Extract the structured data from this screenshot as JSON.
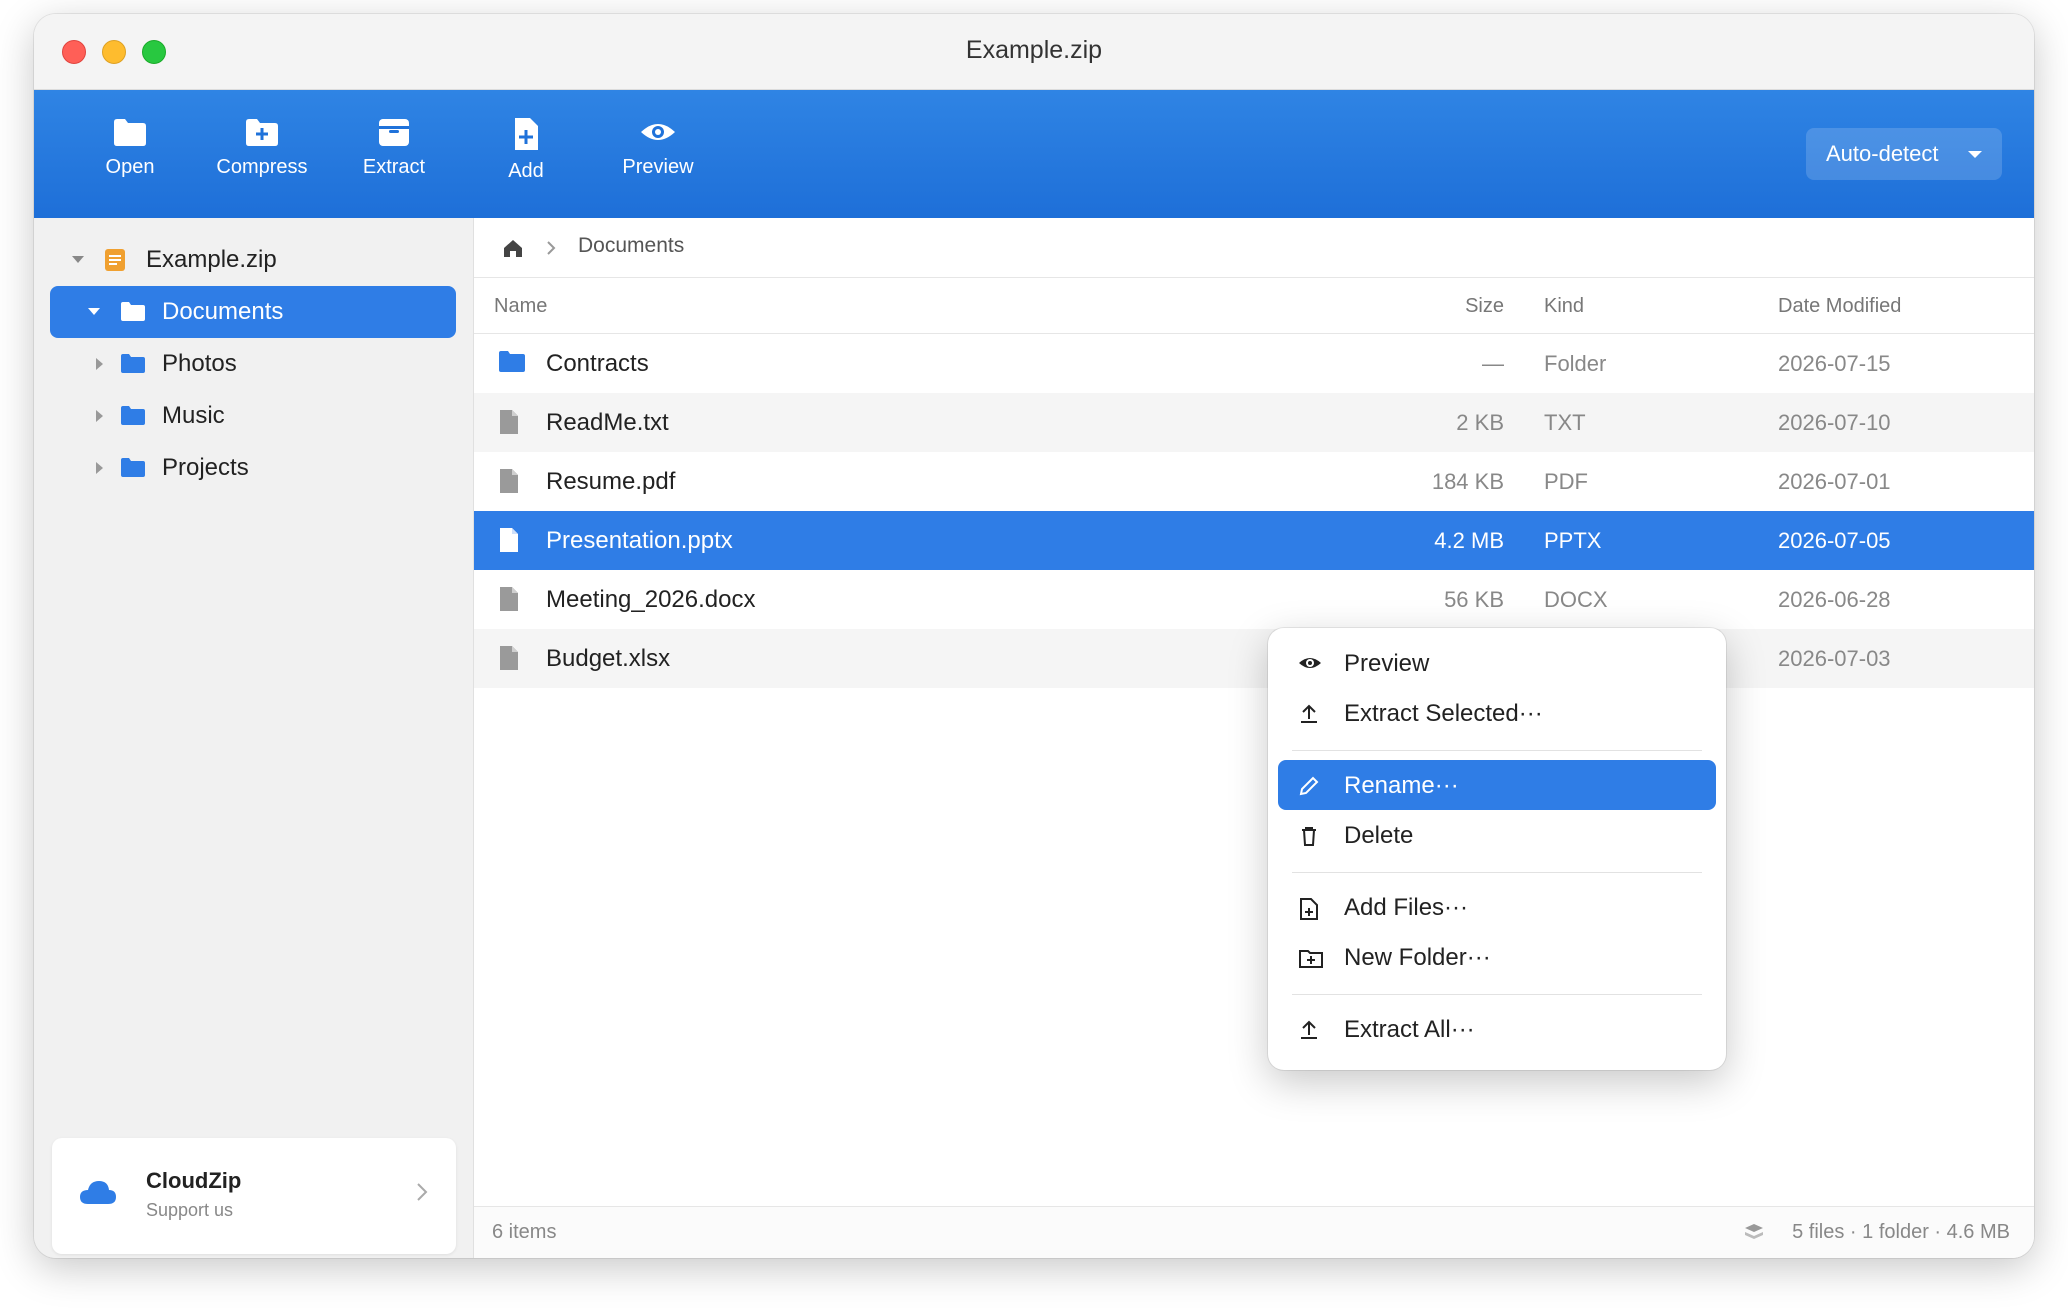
{
  "window": {
    "title": "Example.zip"
  },
  "toolbar": {
    "open": "Open",
    "compress": "Compress",
    "extract": "Extract",
    "add": "Add",
    "preview": "Preview",
    "format_select": "Auto-detect"
  },
  "sidebar": {
    "root": "Example.zip",
    "items": [
      {
        "label": "Documents",
        "selected": true
      },
      {
        "label": "Photos"
      },
      {
        "label": "Music"
      },
      {
        "label": "Projects"
      }
    ],
    "promo": {
      "title": "CloudZip",
      "subtitle": "Support us"
    }
  },
  "breadcrumb": {
    "current": "Documents"
  },
  "columns": {
    "name": "Name",
    "size": "Size",
    "kind": "Kind",
    "date": "Date Modified"
  },
  "files": [
    {
      "name": "Contracts",
      "size": "—",
      "kind": "Folder",
      "date": "2026-07-15",
      "icon": "folder-icon"
    },
    {
      "name": "ReadMe.txt",
      "size": "2 KB",
      "kind": "TXT",
      "date": "2026-07-10",
      "icon": "file-icon"
    },
    {
      "name": "Resume.pdf",
      "size": "184 KB",
      "kind": "PDF",
      "date": "2026-07-01",
      "icon": "file-icon"
    },
    {
      "name": "Presentation.pptx",
      "size": "4.2 MB",
      "kind": "PPTX",
      "date": "2026-07-05",
      "icon": "file-icon",
      "selected": true
    },
    {
      "name": "Meeting_2026.docx",
      "size": "56 KB",
      "kind": "DOCX",
      "date": "2026-06-28",
      "icon": "file-icon"
    },
    {
      "name": "Budget.xlsx",
      "size": "",
      "kind": "",
      "date": "2026-07-03",
      "icon": "file-icon"
    }
  ],
  "context_menu": {
    "preview": "Preview",
    "extract_selected": "Extract Selected···",
    "rename": "Rename···",
    "delete": "Delete",
    "add_files": "Add Files···",
    "new_folder": "New Folder···",
    "extract_all": "Extract All···"
  },
  "status": {
    "items": "6 items",
    "summary": "5 files · 1 folder · 4.6 MB"
  },
  "colors": {
    "accent": "#2f7de6",
    "toolbar": "#1e6fd8",
    "doc_icon": "#f0a030"
  }
}
